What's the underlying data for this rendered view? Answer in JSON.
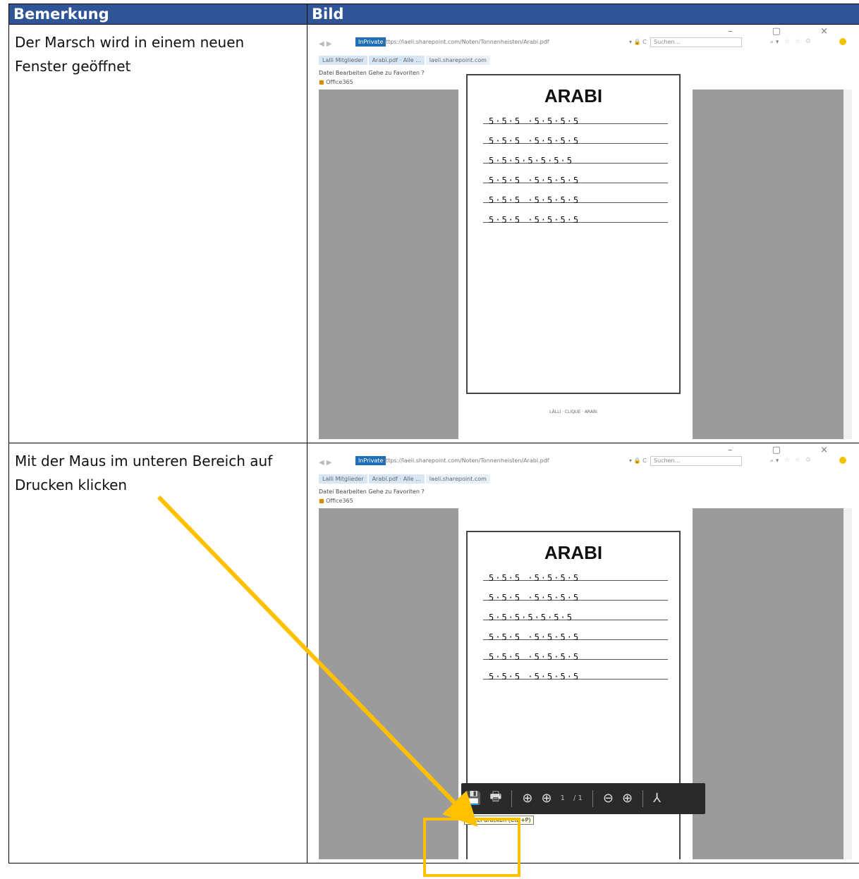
{
  "table": {
    "headers": {
      "remark": "Bemerkung",
      "image": "Bild"
    },
    "rows": [
      {
        "remark": "Der Marsch wird in einem neuen Fenster geöffnet"
      },
      {
        "remark": "Mit der Maus im unteren Bereich auf Drucken klicken"
      }
    ]
  },
  "browser": {
    "window_buttons": "–  ▢  ×",
    "inprivate": "InPrivate",
    "url": "https://laeli.sharepoint.com/Noten/Tonnenheisten/Arabi.pdf",
    "lock": "▾ 🔒 C",
    "search_placeholder": "Suchen...",
    "search_icon": "⌕ ▾",
    "tabs": [
      "Lalli Mitglieder",
      "Arabi.pdf · Alle ...",
      "laeli.sharepoint.com"
    ],
    "menu": "Datei  Bearbeiten  Gehe zu  Favoriten  ?",
    "favorites": "Office365"
  },
  "score": {
    "title": "ARABI",
    "footer": "LÄLLI · CLIQUE · ARABI",
    "lines": [
      "5·5·5 ·5·5·5·5",
      "5·5·5 ·5·5·5·5",
      "5·5·5·5·5·5·5",
      "5·5·5 ·5·5·5·5",
      "5·5·5 ·5·5·5·5",
      "5·5·5 ·5·5·5·5"
    ]
  },
  "toolbar": {
    "save_icon": "save-icon",
    "print_icon": "print-icon",
    "page_number": "1",
    "page_total": "/ 1",
    "tooltip": "Datei drucken (Ctrl+P)"
  },
  "colors": {
    "header_bg": "#2f5597",
    "annotation": "#ffc000",
    "viewer_bg": "#9b9b9b"
  }
}
